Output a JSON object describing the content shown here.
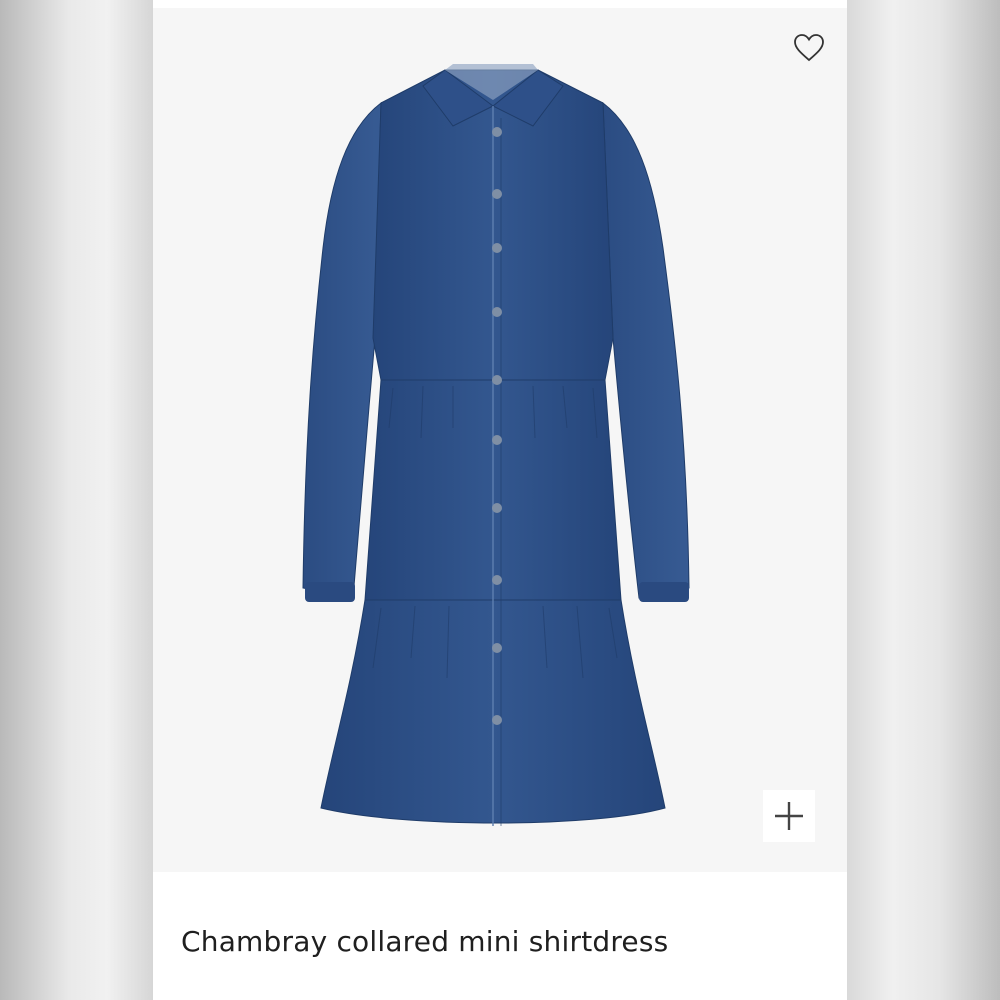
{
  "product": {
    "title": "Chambray collared mini shirtdress",
    "image_icon": "denim-shirtdress-image"
  },
  "actions": {
    "favorite_icon": "heart-icon",
    "add_icon": "plus-icon"
  },
  "colors": {
    "denim": "#2f5288",
    "denim_dark": "#1f3c69",
    "card_background": "#ffffff",
    "photo_background": "#f6f6f6",
    "title_text": "#1f1f1f"
  }
}
